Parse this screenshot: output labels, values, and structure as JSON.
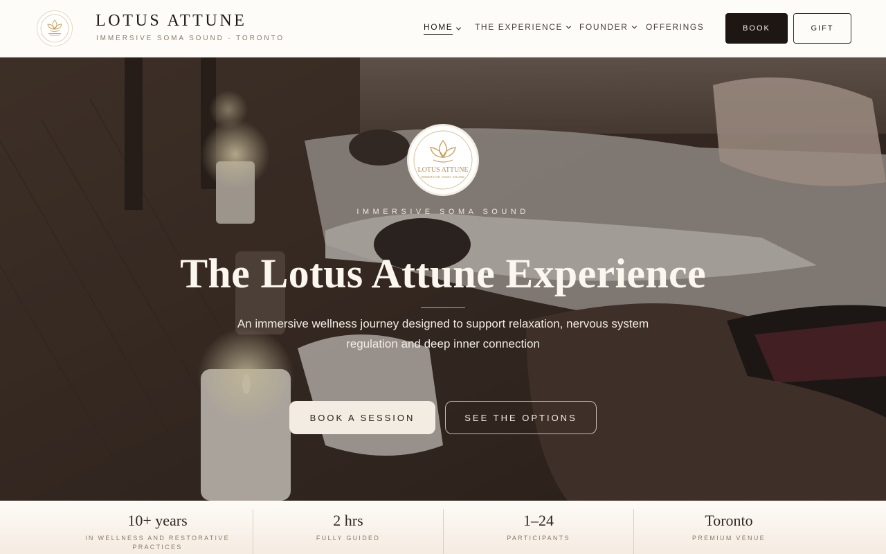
{
  "brand": {
    "title": "LOTUS ATTUNE",
    "subtitle": "IMMERSIVE SOMA SOUND · TORONTO"
  },
  "nav": {
    "items": [
      {
        "label": "HOME",
        "active": true,
        "dropdown": true
      },
      {
        "label": "THE EXPERIENCE",
        "active": false,
        "dropdown": true
      },
      {
        "label": "FOUNDER",
        "active": false,
        "dropdown": true
      },
      {
        "label": "OFFERINGS",
        "active": false,
        "dropdown": false
      }
    ],
    "book_label": "BOOK",
    "gift_label": "GIFT"
  },
  "hero": {
    "emblem_name": "LOTUS ATTUNE",
    "emblem_tagline": "IMMERSIVE SOMA SOUND",
    "kicker": "IMMERSIVE SOMA SOUND",
    "title": "The Lotus Attune Experience",
    "description": "An immersive wellness journey designed to support relaxation, nervous system regulation and deep inner connection",
    "primary_cta": "BOOK A SESSION",
    "secondary_cta": "SEE THE OPTIONS"
  },
  "stats": [
    {
      "value": "10+ years",
      "label": "IN WELLNESS AND RESTORATIVE PRACTICES"
    },
    {
      "value": "2 hrs",
      "label": "FULLY GUIDED"
    },
    {
      "value": "1–24",
      "label": "PARTICIPANTS"
    },
    {
      "value": "Toronto",
      "label": "PREMIUM VENUE"
    }
  ],
  "colors": {
    "gold": "#c9ab7a",
    "dark": "#1d1612",
    "cream": "#f3ece3"
  },
  "icons": [
    "lotus-logo-icon",
    "chevron-down-icon"
  ]
}
